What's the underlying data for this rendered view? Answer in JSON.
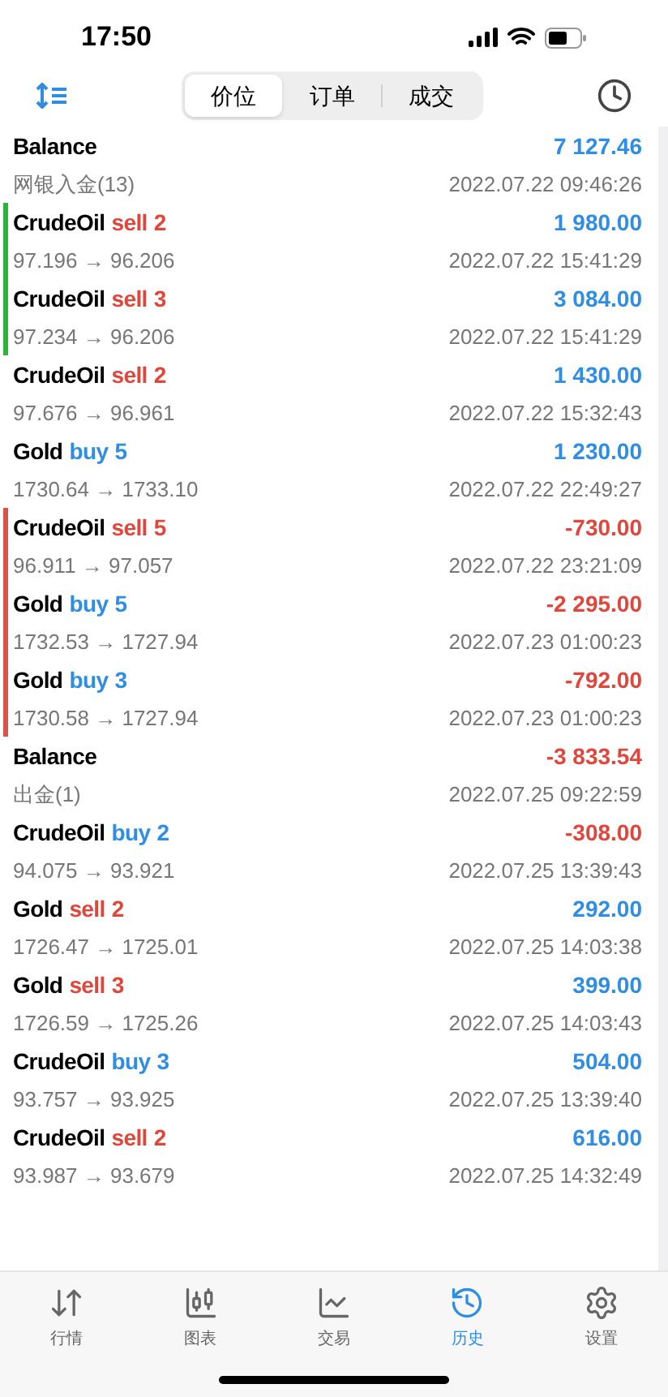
{
  "status_bar": {
    "time": "17:50"
  },
  "segments": [
    {
      "label": "价位",
      "selected": true
    },
    {
      "label": "订单",
      "selected": false
    },
    {
      "label": "成交",
      "selected": false
    }
  ],
  "deals": [
    {
      "kind": "balance",
      "symbol": "Balance",
      "detail": "网银入金(13)",
      "amount": "7 127.46",
      "positive": true,
      "time": "2022.07.22 09:46:26"
    },
    {
      "kind": "trade",
      "symbol": "CrudeOil",
      "order": {
        "kind": "sell",
        "side": "sell",
        "lots": "2"
      },
      "detail": "97.196 → 96.206",
      "amount": "1 980.00",
      "positive": true,
      "time": "2022.07.22 15:41:29",
      "color": "#2bb33a"
    },
    {
      "kind": "trade",
      "symbol": "CrudeOil",
      "order": {
        "kind": "sell",
        "side": "sell",
        "lots": "3"
      },
      "detail": "97.234 → 96.206",
      "amount": "3 084.00",
      "positive": true,
      "time": "2022.07.22 15:41:29",
      "color": "#2bb33a"
    },
    {
      "kind": "trade",
      "symbol": "CrudeOil",
      "order": {
        "kind": "sell",
        "side": "sell",
        "lots": "2"
      },
      "detail": "97.676 → 96.961",
      "amount": "1 430.00",
      "positive": true,
      "time": "2022.07.22 15:32:43"
    },
    {
      "kind": "trade",
      "symbol": "Gold",
      "order": {
        "kind": "buy",
        "side": "buy",
        "lots": "5"
      },
      "detail": "1730.64 → 1733.10",
      "amount": "1 230.00",
      "positive": true,
      "time": "2022.07.22 22:49:27"
    },
    {
      "kind": "trade",
      "symbol": "CrudeOil",
      "order": {
        "kind": "sell",
        "side": "sell",
        "lots": "5"
      },
      "detail": "96.911 → 97.057",
      "amount": "-730.00",
      "positive": false,
      "time": "2022.07.22 23:21:09",
      "color": "#d9534a"
    },
    {
      "kind": "trade",
      "symbol": "Gold",
      "order": {
        "kind": "buy",
        "side": "buy",
        "lots": "5"
      },
      "detail": "1732.53 → 1727.94",
      "amount": "-2 295.00",
      "positive": false,
      "time": "2022.07.23 01:00:23",
      "color": "#d9534a"
    },
    {
      "kind": "trade",
      "symbol": "Gold",
      "order": {
        "kind": "buy",
        "side": "buy",
        "lots": "3"
      },
      "detail": "1730.58 → 1727.94",
      "amount": "-792.00",
      "positive": false,
      "time": "2022.07.23 01:00:23",
      "color": "#d9534a"
    },
    {
      "kind": "balance",
      "symbol": "Balance",
      "detail": "出金(1)",
      "amount": "-3 833.54",
      "positive": false,
      "time": "2022.07.25 09:22:59"
    },
    {
      "kind": "trade",
      "symbol": "CrudeOil",
      "order": {
        "kind": "buy",
        "side": "buy",
        "lots": "2"
      },
      "detail": "94.075 → 93.921",
      "amount": "-308.00",
      "positive": false,
      "time": "2022.07.25 13:39:43"
    },
    {
      "kind": "trade",
      "symbol": "Gold",
      "order": {
        "kind": "sell",
        "side": "sell",
        "lots": "2"
      },
      "detail": "1726.47 → 1725.01",
      "amount": "292.00",
      "positive": true,
      "time": "2022.07.25 14:03:38"
    },
    {
      "kind": "trade",
      "symbol": "Gold",
      "order": {
        "kind": "sell",
        "side": "sell",
        "lots": "3"
      },
      "detail": "1726.59 → 1725.26",
      "amount": "399.00",
      "positive": true,
      "time": "2022.07.25 14:03:43"
    },
    {
      "kind": "trade",
      "symbol": "CrudeOil",
      "order": {
        "kind": "buy",
        "side": "buy",
        "lots": "3"
      },
      "detail": "93.757 → 93.925",
      "amount": "504.00",
      "positive": true,
      "time": "2022.07.25 13:39:40"
    },
    {
      "kind": "trade",
      "symbol": "CrudeOil",
      "order": {
        "kind": "sell",
        "side": "sell",
        "lots": "2"
      },
      "detail": "93.987 → 93.679",
      "amount": "616.00",
      "positive": true,
      "time": "2022.07.25 14:32:49"
    }
  ],
  "tab_bar": [
    {
      "kind": "quotes",
      "label": "行情",
      "selected": false
    },
    {
      "kind": "chart",
      "label": "图表",
      "selected": false
    },
    {
      "kind": "trade",
      "label": "交易",
      "selected": false
    },
    {
      "kind": "history",
      "label": "历史",
      "selected": true
    },
    {
      "kind": "settings",
      "label": "设置",
      "selected": false
    }
  ]
}
